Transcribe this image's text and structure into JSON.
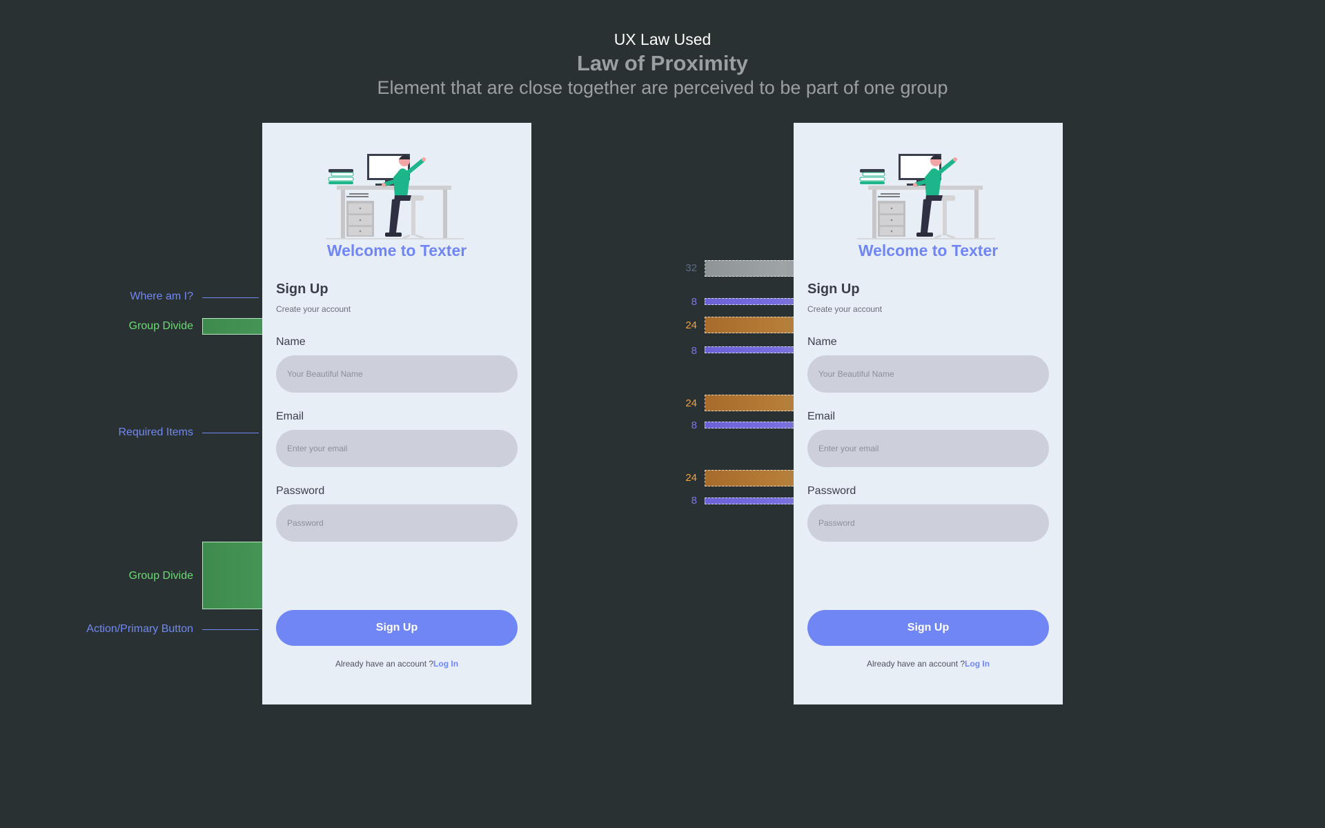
{
  "header": {
    "law_used": "UX Law Used",
    "title": "Law of Proximity",
    "subtitle": "Element that are close together are perceived to be part of one group"
  },
  "phone": {
    "welcome": "Welcome to Texter",
    "signup_title": "Sign Up",
    "signup_subtitle": "Create your account",
    "name_label": "Name",
    "name_placeholder": "Your Beautiful Name",
    "email_label": "Email",
    "email_placeholder": "Enter your email",
    "password_label": "Password",
    "password_placeholder": "Password",
    "button_label": "Sign Up",
    "login_prompt": "Already have an account ?",
    "login_link": "Log In"
  },
  "annotations": {
    "where_am_i": "Where am I?",
    "group_divide_1": "Group Divide",
    "required_items": "Required Items",
    "group_divide_2": "Group Divide",
    "action_button": "Action/Primary Button"
  },
  "spacing": [
    {
      "value": "32",
      "color": "grey"
    },
    {
      "value": "8",
      "color": "blue"
    },
    {
      "value": "24",
      "color": "orange"
    },
    {
      "value": "8",
      "color": "blue"
    },
    {
      "value": "24",
      "color": "orange"
    },
    {
      "value": "8",
      "color": "blue"
    },
    {
      "value": "24",
      "color": "orange"
    },
    {
      "value": "8",
      "color": "blue"
    }
  ],
  "colors": {
    "background": "#293133",
    "card": "#e8eef5",
    "accent": "#6f86f4",
    "annotation_green": "#6bdc73",
    "spacing_orange": "#f4a23a",
    "spacing_blue": "#7e76e8"
  }
}
